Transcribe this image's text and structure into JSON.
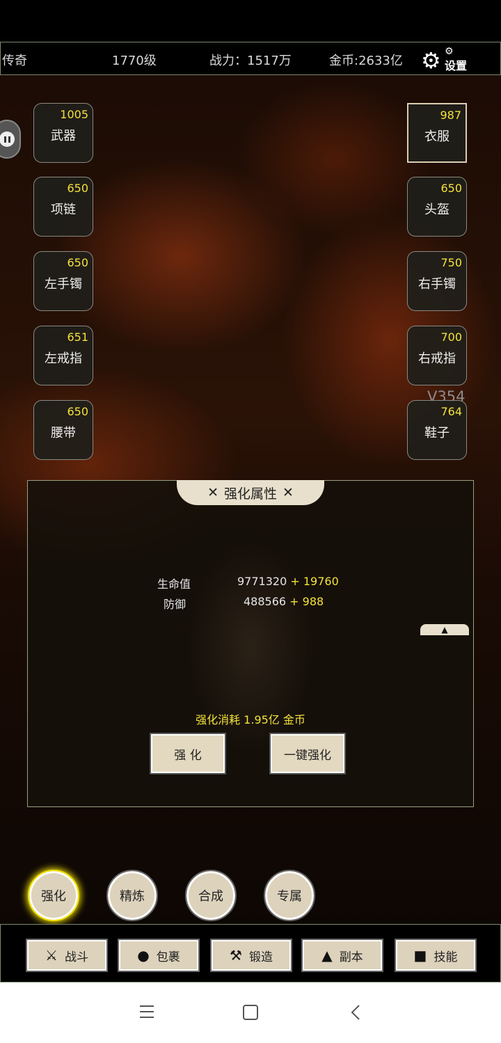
{
  "header": {
    "rank": "传奇",
    "level": "1770级",
    "power": "战力：1517万",
    "gold": "金币:2633亿",
    "settings_label": "设置",
    "settings_icon": "gear-icon"
  },
  "equipment": {
    "left": [
      {
        "level": "1005",
        "name": "武器"
      },
      {
        "level": "650",
        "name": "项链"
      },
      {
        "level": "650",
        "name": "左手镯"
      },
      {
        "level": "651",
        "name": "左戒指"
      },
      {
        "level": "650",
        "name": "腰带"
      }
    ],
    "right": [
      {
        "level": "987",
        "name": "衣服"
      },
      {
        "level": "650",
        "name": "头盔"
      },
      {
        "level": "750",
        "name": "右手镯"
      },
      {
        "level": "700",
        "name": "右戒指"
      },
      {
        "level": "764",
        "name": "鞋子"
      }
    ],
    "selected": "衣服"
  },
  "version": "V354",
  "panel": {
    "title": "强化属性",
    "attributes": [
      {
        "name": "生命值",
        "value": "9771320",
        "bonus": "+ 19760"
      },
      {
        "name": "防御",
        "value": "488566",
        "bonus": "+ 988"
      }
    ],
    "cost": "强化消耗  1.95亿 金币",
    "enhance_button": "强 化",
    "one_key_button": "一键强化"
  },
  "mode_tabs": [
    {
      "label": "强化",
      "active": true
    },
    {
      "label": "精炼",
      "active": false
    },
    {
      "label": "合成",
      "active": false
    },
    {
      "label": "专属",
      "active": false
    }
  ],
  "nav": [
    {
      "label": "战斗",
      "icon": "crossed-swords-icon"
    },
    {
      "label": "包裹",
      "icon": "bag-icon"
    },
    {
      "label": "锻造",
      "icon": "hammer-icon"
    },
    {
      "label": "副本",
      "icon": "tower-icon"
    },
    {
      "label": "技能",
      "icon": "book-icon"
    }
  ],
  "colors": {
    "accent_yellow": "#f4e23a",
    "button_beige": "#ddd2bc",
    "border_green": "#7b8a6a"
  }
}
